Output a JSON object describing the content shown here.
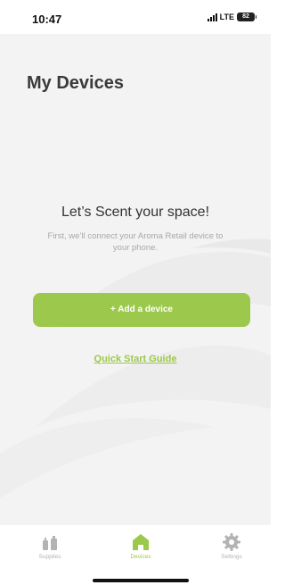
{
  "status_bar": {
    "time": "10:47",
    "network": "LTE",
    "battery": "82"
  },
  "page": {
    "title": "My Devices"
  },
  "empty_state": {
    "heading": "Let’s Scent your space!",
    "subtext": "First, we’ll connect your Aroma Retail device to your phone.",
    "add_button_label": "+ Add a device",
    "guide_link_label": "Quick Start Guide"
  },
  "tab_bar": {
    "supplies": {
      "label": "Supplies",
      "icon": "supplies-icon"
    },
    "devices": {
      "label": "Devices",
      "icon": "home-icon"
    },
    "settings": {
      "label": "Settings",
      "icon": "gear-icon"
    },
    "active": "Devices"
  },
  "colors": {
    "accent": "#9cc84b",
    "background": "#f3f3f3",
    "inactive_tab": "#b3b3b3"
  }
}
